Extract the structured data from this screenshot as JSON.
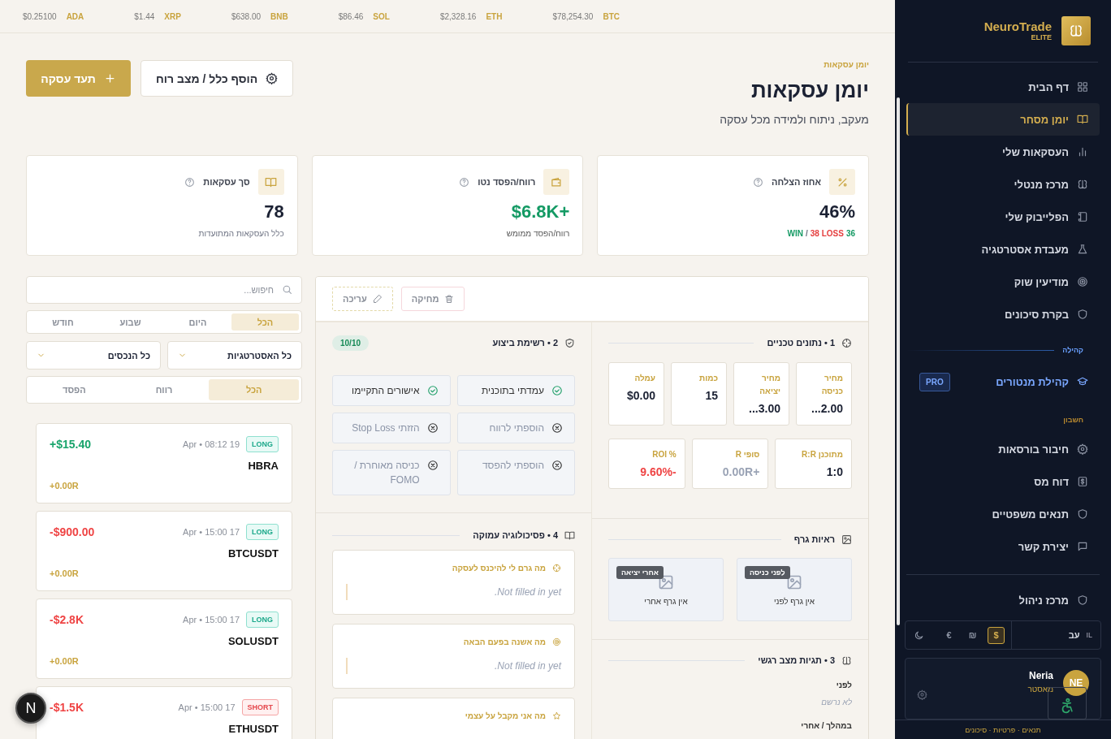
{
  "ticker": [
    {
      "symbol": "BTC",
      "price": "$78,254.30"
    },
    {
      "symbol": "ETH",
      "price": "$2,328.16"
    },
    {
      "symbol": "SOL",
      "price": "$86.46"
    },
    {
      "symbol": "BNB",
      "price": "$638.00"
    },
    {
      "symbol": "XRP",
      "price": "$1.44"
    },
    {
      "symbol": "ADA",
      "price": "$0.25100"
    }
  ],
  "header": {
    "breadcrumb": "יומן עסקאות",
    "title": "יומן עסקאות",
    "subtitle": "מעקב, ניתוח ולמידה מכל עסקה",
    "buttons": [
      {
        "kind": "secondary",
        "label": "הוסף כלל / מצב רוח"
      },
      {
        "kind": "primary",
        "label": "תעד עסקה"
      }
    ]
  },
  "stats": [
    {
      "label": "אחוז הצלחה",
      "value": "46%",
      "color": "#1b2133",
      "sub": [
        {
          "text": "36",
          "color": "#149a64"
        },
        {
          "text": "38 LOSS",
          "color": "#e53e3e"
        },
        {
          "text": "/",
          "color": "#6b7080"
        },
        {
          "text": "WIN",
          "color": "#149a64"
        }
      ]
    },
    {
      "label": "רווח/הפסד נטו",
      "value": "$6.8K+",
      "color": "#149a64",
      "sub": [
        {
          "text": "רווח/הפסד ממומש",
          "color": "#555555"
        }
      ]
    },
    {
      "label": "סך עסקאות",
      "value": "78",
      "color": "#1b2133",
      "sub": [
        {
          "text": "כלל העסקאות המתועדות",
          "color": "#6b7080"
        }
      ]
    }
  ],
  "filters": {
    "search": {
      "placeholder": "חיפוש..."
    },
    "period_tabs": [
      {
        "label": "הכל",
        "selected": true
      },
      {
        "label": "היום",
        "selected": false
      },
      {
        "label": "שבוע",
        "selected": false
      },
      {
        "label": "חודש",
        "selected": false
      }
    ],
    "dropdowns": [
      {
        "value": "כל האסטרטגיות"
      },
      {
        "value": "כל הנכסים"
      }
    ],
    "result_tabs": [
      {
        "label": "הכל",
        "selected": true
      },
      {
        "label": "רווח",
        "selected": false
      },
      {
        "label": "הפסד",
        "selected": false
      }
    ]
  },
  "trades": [
    {
      "symbol": "HBRA",
      "side": "LONG",
      "kind": "long",
      "date": "Apr • 08:12 19",
      "pnl": "+$15.40",
      "color": "#18a46b",
      "r": "+0.00R"
    },
    {
      "symbol": "BTCUSDT",
      "side": "LONG",
      "kind": "long",
      "date": "Apr • 15:00 17",
      "pnl": "-$900.00",
      "color": "#ef4444",
      "r": "+0.00R"
    },
    {
      "symbol": "SOLUSDT",
      "side": "LONG",
      "kind": "long",
      "date": "Apr • 15:00 17",
      "pnl": "-$2.8K",
      "color": "#ef4444",
      "r": "+0.00R"
    },
    {
      "symbol": "ETHUSDT",
      "side": "SHORT",
      "kind": "short",
      "date": "Apr • 15:00 17",
      "pnl": "-$1.5K",
      "color": "#ef4444"
    }
  ],
  "detail": {
    "actions": [
      {
        "kind": "delete",
        "label": "מחיקה"
      },
      {
        "kind": "edit",
        "label": "עריכה"
      }
    ],
    "technical": {
      "title": "1 • נתונים טכניים",
      "metrics": [
        {
          "label": "מחיר כניסה",
          "value": "...2.00"
        },
        {
          "label": "מחיר יציאה",
          "value": "...3.00"
        },
        {
          "label": "כמות",
          "value": "15"
        },
        {
          "label": "עמלה",
          "value": "$0.00"
        }
      ],
      "ratios": [
        {
          "label": "מתוכנן R:R",
          "value": "1:0",
          "color": "#1b2133"
        },
        {
          "label": "סופי R",
          "value": "0.00R+",
          "color": "#9aa3b5"
        },
        {
          "label": "% ROI",
          "value": "9.60%-",
          "color": "#ef4444"
        }
      ]
    },
    "charts": {
      "title": "ראיות גרף",
      "items": [
        {
          "tag": "לפני כניסה",
          "text": "אין גרף לפני"
        },
        {
          "tag": "אחרי יציאה",
          "text": "אין גרף אחרי"
        }
      ]
    },
    "emotions": {
      "title": "3 • תגיות מצב רגשי",
      "groups": [
        {
          "label": "לפני",
          "value": "לא נרשם"
        },
        {
          "label": "במהלך / אחרי"
        }
      ]
    },
    "checklist": {
      "title": "2 • רשימת ביצוע",
      "score": "10/10",
      "items": [
        {
          "label": "עמדתי בתוכנית",
          "checked": true
        },
        {
          "label": "אישורים התקיימו",
          "checked": true
        },
        {
          "label": "הוספתי לרווח",
          "checked": false
        },
        {
          "label": "הזזתי Stop Loss",
          "checked": false
        },
        {
          "label": "הוספתי להפסד",
          "checked": false
        },
        {
          "label": "כניסה מאוחרת / FOMO",
          "checked": false
        }
      ]
    },
    "psychology": {
      "title": "4 • פסיכולוגיה עמוקה",
      "cards": [
        {
          "question": "מה גרם לי להיכנס לעסקה",
          "answer": "Not filled in yet."
        },
        {
          "question": "מה אשנה בפעם הבאה",
          "answer": "Not filled in yet."
        },
        {
          "question": "מה אני מקבל על עצמי"
        }
      ]
    }
  },
  "sidebar": {
    "brand": "NeuroTrade",
    "tier": "ELITE",
    "groups": [
      {
        "kind": "main",
        "items": [
          {
            "label": "דף הבית",
            "selected": false
          },
          {
            "label": "יומן מסחר",
            "selected": true
          },
          {
            "label": "העסקאות שלי",
            "selected": false
          },
          {
            "label": "מרכז מנטלי",
            "selected": false
          },
          {
            "label": "הפלייבוק שלי",
            "selected": false
          },
          {
            "label": "מעבדת אסטרטגיה",
            "selected": false
          },
          {
            "label": "מודיעין שוק",
            "selected": false
          },
          {
            "label": "בקרת סיכונים",
            "selected": false
          }
        ]
      },
      {
        "kind": "community",
        "heading": "קהילה",
        "items": [
          {
            "label": "קהילת מנטורים",
            "badge": "PRO",
            "selected": false
          }
        ]
      },
      {
        "kind": "account",
        "heading": "חשבון",
        "items": [
          {
            "label": "חיבור בורסאות",
            "selected": false
          },
          {
            "label": "דוח מס",
            "selected": false
          },
          {
            "label": "תנאים משפטיים",
            "selected": false
          },
          {
            "label": "יצירת קשר",
            "selected": false
          }
        ]
      },
      {
        "kind": "admin",
        "items": [
          {
            "label": "מרכז ניהול",
            "selected": false
          }
        ]
      }
    ],
    "language": {
      "label": "עב",
      "flag": "IL"
    },
    "currencies": [
      {
        "symbol": "$",
        "selected": true
      },
      {
        "symbol": "₪",
        "selected": false
      },
      {
        "symbol": "€",
        "selected": false
      }
    ],
    "user": {
      "initials": "NE",
      "name": "Neria",
      "rank": "מאסטר"
    },
    "footer": "תנאים · פרטיות · סיכונים"
  },
  "dev_badge": "N"
}
